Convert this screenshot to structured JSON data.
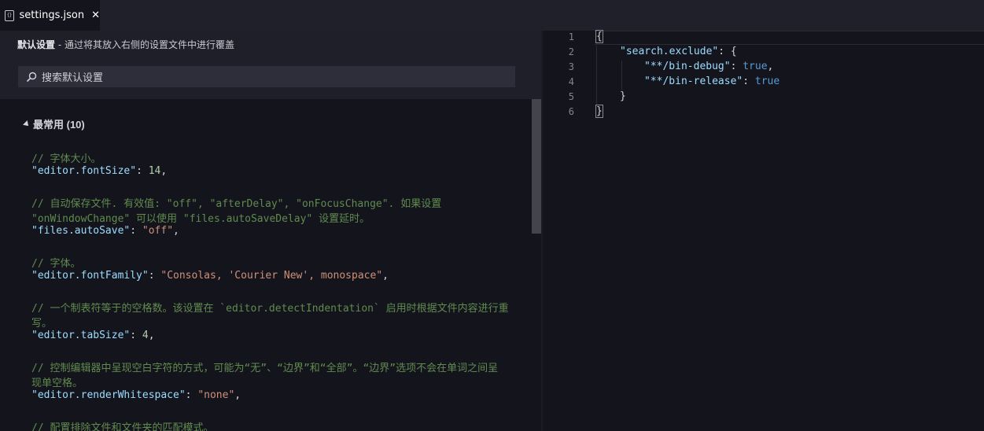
{
  "tab": {
    "title": "settings.json",
    "close": "✕",
    "icon_text": "{}"
  },
  "left": {
    "header_bold": "默认设置",
    "header_rest": " - 通过将其放入右侧的设置文件中进行覆盖",
    "search_placeholder": "搜索默认设置",
    "section_title": "最常用 (10)",
    "lines": [
      {
        "c": "// 字体大小。"
      },
      {
        "k": "\"editor.fontSize\"",
        "v": "14",
        "vt": "num"
      },
      {
        "c": "// 自动保存文件. 有效值: \"off\", \"afterDelay\", \"onFocusChange\". 如果设置"
      },
      {
        "c": "\"onWindowChange\" 可以使用 \"files.autoSaveDelay\" 设置延时。"
      },
      {
        "k": "\"files.autoSave\"",
        "v": "\"off\"",
        "vt": "str"
      },
      {
        "c": "// 字体。"
      },
      {
        "k": "\"editor.fontFamily\"",
        "v": "\"Consolas, 'Courier New', monospace\"",
        "vt": "str"
      },
      {
        "c": "// 一个制表符等于的空格数。该设置在 `editor.detectIndentation` 启用时根据文件内容进行重"
      },
      {
        "c": "写。"
      },
      {
        "k": "\"editor.tabSize\"",
        "v": "4",
        "vt": "num"
      },
      {
        "c": "// 控制编辑器中呈现空白字符的方式，可能为“无”、“边界”和“全部”。“边界”选项不会在单词之间呈"
      },
      {
        "c": "现单空格。"
      },
      {
        "k": "\"editor.renderWhitespace\"",
        "v": "\"none\"",
        "vt": "str"
      },
      {
        "c": "// 配置排除文件和文件夹的匹配模式。"
      }
    ]
  },
  "right": {
    "line_numbers": [
      "1",
      "2",
      "3",
      "4",
      "5",
      "6"
    ],
    "lines": [
      {
        "text": "{"
      },
      {
        "k": "\"search.exclude\"",
        "rest": ": {"
      },
      {
        "k": "\"**/bin-debug\"",
        "v": "true",
        "tail": ","
      },
      {
        "k": "\"**/bin-release\"",
        "v": "true",
        "tail": ""
      },
      {
        "text": "}"
      },
      {
        "text": "}"
      }
    ]
  },
  "colors": {
    "background": "#14141d",
    "comment": "#608b4e",
    "key": "#9cdcfe",
    "string": "#ce9178",
    "number": "#b5cea8",
    "boolean": "#569cd6"
  }
}
